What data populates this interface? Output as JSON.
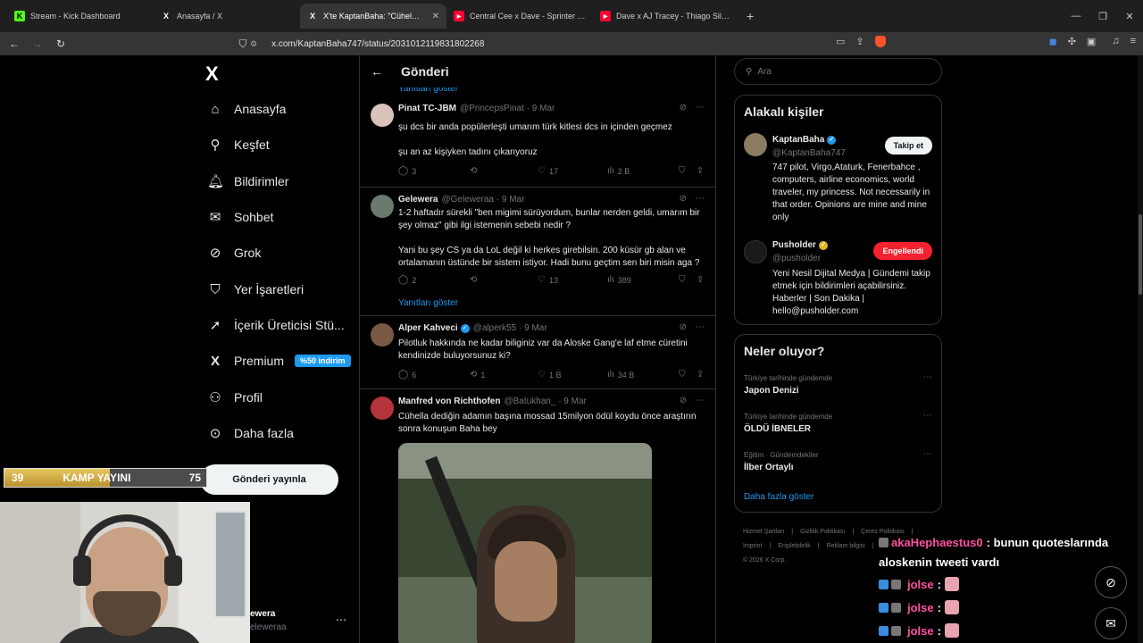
{
  "browser": {
    "tabs": [
      {
        "title": "Stream - Kick Dashboard",
        "icon": "kick-icon",
        "active": false
      },
      {
        "title": "Anasayfa / X",
        "icon": "x-icon",
        "active": false
      },
      {
        "title": "X'te KaptanBaha: \"Cühelanın öz",
        "icon": "x-icon",
        "active": true,
        "close": "✕"
      },
      {
        "title": "Central Cee x Dave - Sprinter [Music",
        "icon": "youtube-icon",
        "active": false
      },
      {
        "title": "Dave x AJ Tracey - Thiago Silva - You",
        "icon": "youtube-icon",
        "active": false
      }
    ],
    "new_tab": "+",
    "url": "x.com/KaptanBaha747/status/2031012119831802268"
  },
  "nav": {
    "items": [
      {
        "label": "Anasayfa",
        "icon": "home-icon",
        "glyph": "⌂"
      },
      {
        "label": "Keşfet",
        "icon": "search-icon",
        "glyph": "⚲"
      },
      {
        "label": "Bildirimler",
        "icon": "bell-icon",
        "glyph": "♫"
      },
      {
        "label": "Sohbet",
        "icon": "mail-icon",
        "glyph": "✉"
      },
      {
        "label": "Grok",
        "icon": "grok-icon",
        "glyph": "⊘"
      },
      {
        "label": "Yer İşaretleri",
        "icon": "bookmark-icon",
        "glyph": "⛉"
      },
      {
        "label": "İçerik Üreticisi Stü...",
        "icon": "rocket-icon",
        "glyph": "➚"
      },
      {
        "label": "Premium",
        "icon": "x-premium-icon",
        "glyph": "X"
      },
      {
        "label": "Profil",
        "icon": "profile-icon",
        "glyph": "⚇"
      },
      {
        "label": "Daha fazla",
        "icon": "more-icon",
        "glyph": "⋯"
      }
    ],
    "premium_badge": "%50 indirim",
    "post_button": "Gönderi yayınla",
    "account_name": "ewera",
    "account_handle": "eleweraa"
  },
  "overlay": {
    "kamp_left": "39",
    "kamp_label": "KAMP YAYINI",
    "kamp_right": "75",
    "kamp_progress": 0.52
  },
  "center": {
    "title": "Gönderi",
    "show_replies_top": "Yanıtları göster",
    "posts": [
      {
        "name": "Pinat TC-JBM",
        "handle": "@PrincepsPinat · 9 Mar",
        "text1": "şu dcs bir anda popülerleşti umarım türk kitlesi dcs in içinden geçmez",
        "text2": "şu an az kişiyken tadını çıkarıyoruz",
        "replies": "3",
        "reposts": "",
        "likes": "17",
        "views": "2 B"
      },
      {
        "name": "Gelewera",
        "handle": "@Geleweraa · 9 Mar",
        "text1": "1-2 haftadır sürekli \"ben migimi sürüyordum, bunlar nerden geldi, umarım bir şey olmaz\" gibi ilgi istemenin sebebi nedir ?",
        "text2": "Yani bu şey CS ya da LoL değil ki herkes girebilsin. 200 küsür gb alan ve ortalamanın üstünde bir sistem istiyor. Hadi bunu geçtim sen biri misin aga ?",
        "replies": "2",
        "reposts": "",
        "likes": "13",
        "views": "389",
        "show_replies": "Yanıtları göster"
      },
      {
        "name": "Alper Kahveci",
        "handle": "@alperk55 · 9 Mar",
        "text1": "Pilotluk hakkında ne kadar biliginiz var da Aloske Gang'e laf etme cüretini kendinizde buluyorsunuz ki?",
        "replies": "6",
        "reposts": "1",
        "likes": "1 B",
        "views": "34 B"
      },
      {
        "name": "Manfred von Richthofen",
        "handle": "@Batukhan_ · 9 Mar",
        "text1": "Cühella dediğin adamın başına mossad 15milyon ödül koydu önce araştırın sonra konuşun Baha bey"
      }
    ]
  },
  "right": {
    "search_placeholder": "Ara",
    "people_title": "Alakalı kişiler",
    "people": [
      {
        "name": "KaptanBaha",
        "handle": "@KaptanBaha747",
        "bio": "747 pilot, Virgo,Ataturk, Fenerbahce , computers, airline economics, world traveler, my princess. Not necessarily in that order. Opinions are mine and mine only",
        "button": "Takip et"
      },
      {
        "name": "Pusholder",
        "handle": "@pusholder",
        "bio": "Yeni Nesil Dijital Medya | Gündemi takip etmek için bildirimleri açabilirsiniz. Haberler | Son Dakika | hello@pusholder.com",
        "button": "Engellendi"
      }
    ],
    "trends_title": "Neler oluyor?",
    "trends": [
      {
        "category": "Türkiye tarihinde gündemde",
        "name": "Japon Denizi"
      },
      {
        "category": "Türkiye tarihinde gündemde",
        "name": "ÖLDÜ İBNELER"
      },
      {
        "category": "Eğitim · Gündemdekiler",
        "name": "İlber Ortaylı"
      }
    ],
    "trends_more": "Daha fazla göster",
    "footer": [
      "Hizmet Şartları",
      "|",
      "Gizlilik Politikası",
      "|",
      "Çerez Politikası",
      "|",
      "Imprint",
      "|",
      "Erişilebilirlik",
      "|",
      "Reklam bilgisi",
      "|",
      "© 2026 X Corp."
    ]
  },
  "chat": [
    {
      "user": "akaHephaestus0",
      "message": ": bunun quoteslarında",
      "message2": "aloskenin tweeti vardı"
    },
    {
      "user": "jolse",
      "message": ":"
    },
    {
      "user": "jolse",
      "message": ":"
    },
    {
      "user": "jolse",
      "message": ":"
    }
  ],
  "colors": {
    "accent": "#1d9bf0",
    "danger": "#f4212e",
    "chat_user": "#ff4fa3",
    "kamp_gold": "#d9b44a"
  }
}
